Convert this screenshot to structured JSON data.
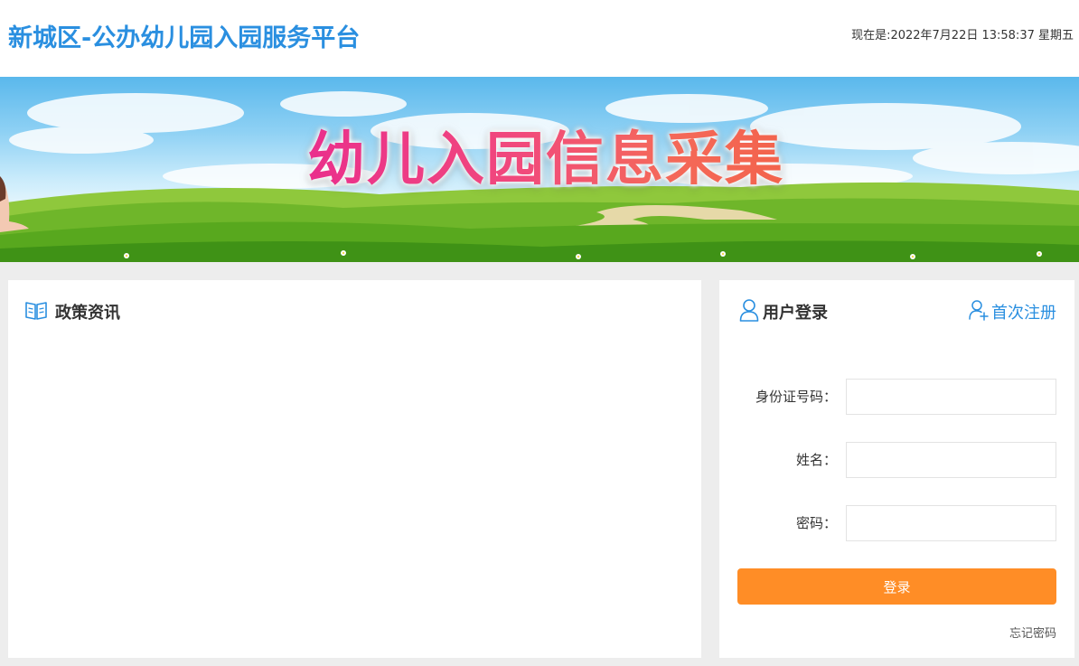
{
  "header": {
    "title": "新城区-公办幼儿园入园服务平台",
    "clock": "现在是:2022年7月22日 13:58:37 星期五"
  },
  "banner": {
    "title": "幼儿入园信息采集"
  },
  "policy_panel": {
    "title": "政策资讯",
    "icon": "book-icon"
  },
  "login_panel": {
    "title": "用户登录",
    "icon": "user-icon",
    "register_label": "首次注册",
    "register_icon": "user-add-icon",
    "fields": {
      "id_label": "身份证号码：",
      "id_value": "",
      "name_label": "姓名：",
      "name_value": "",
      "password_label": "密码：",
      "password_value": ""
    },
    "login_button": "登录",
    "forgot_link": "忘记密码"
  },
  "colors": {
    "brand_blue": "#2a8fe0",
    "login_orange": "#ff8d26",
    "page_bg": "#ededed"
  }
}
